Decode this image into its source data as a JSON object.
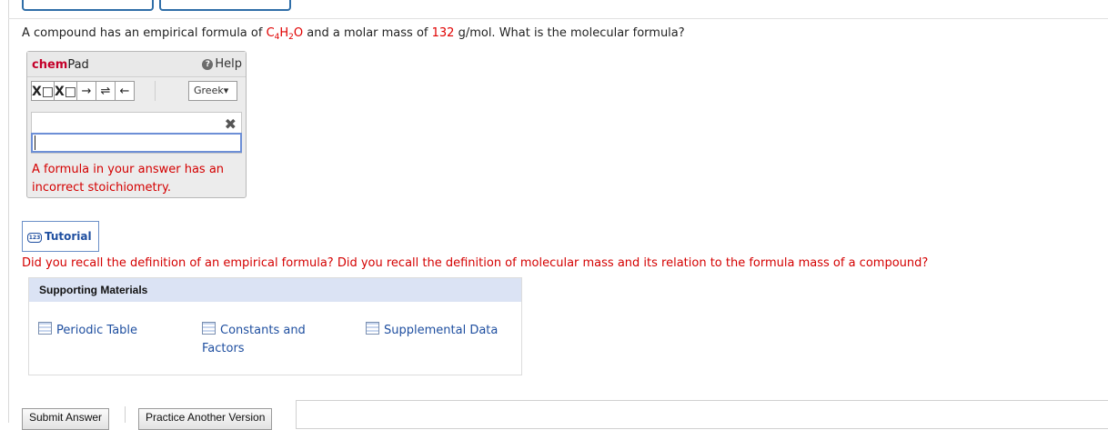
{
  "question": {
    "prefix": "A compound has an empirical formula of ",
    "formula_c": "C",
    "formula_c_sub": "4",
    "formula_h": "H",
    "formula_h_sub": "2",
    "formula_o": "O",
    "middle": " and a molar mass of ",
    "molar_mass": "132",
    "suffix": " g/mol. What is the molecular formula?"
  },
  "chempad": {
    "title_bold": "chem",
    "title_rest": "Pad",
    "help_label": "Help",
    "tools": {
      "subscript": "X□",
      "superscript": "X□",
      "arrow": "→",
      "equilibrium": "⇌",
      "back_arrow": "←"
    },
    "greek_label": "Greek▾",
    "clear_glyph": "✖",
    "answer_value": "",
    "error": "A formula in your answer has an incorrect stoichiometry."
  },
  "tutorial": {
    "icon_text": "123",
    "label": "Tutorial"
  },
  "hint": "Did you recall the definition of an empirical formula? Did you recall the definition of molecular mass and its relation to the formula mass of a compound?",
  "supporting": {
    "title": "Supporting Materials",
    "links": [
      "Periodic Table",
      "Constants and Factors",
      "Supplemental Data"
    ]
  },
  "buttons": {
    "submit": "Submit Answer",
    "practice": "Practice Another Version"
  },
  "colors": {
    "error_red": "#d40000",
    "link_blue": "#1f4fa0",
    "header_blue": "#dbe3f4"
  }
}
